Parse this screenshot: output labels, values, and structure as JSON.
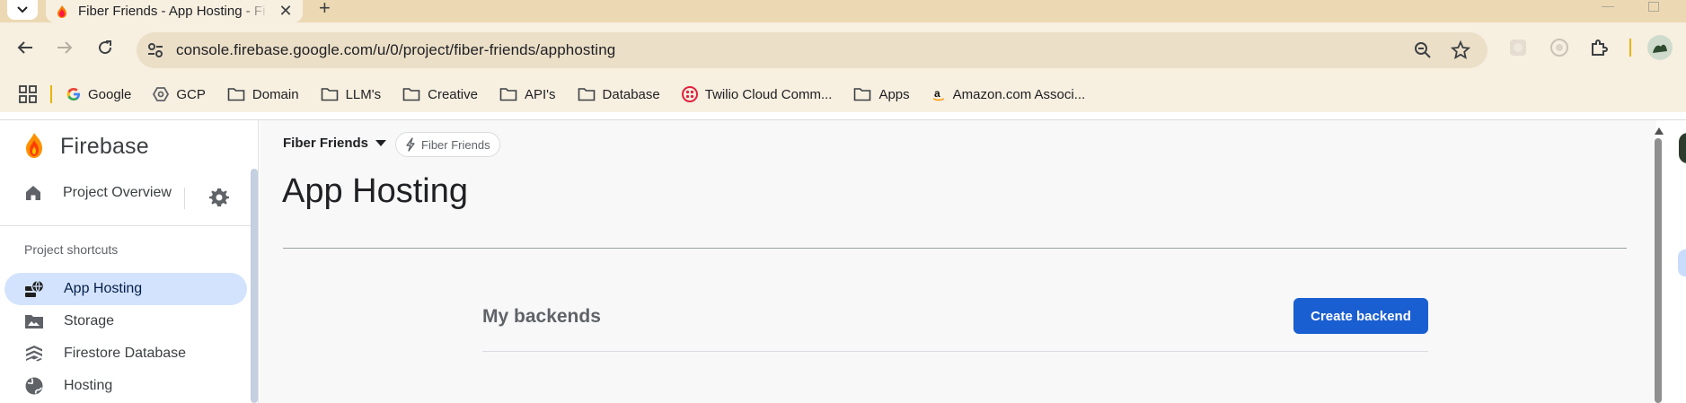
{
  "browser": {
    "tab": {
      "title": "Fiber Friends - App Hosting - Fi"
    },
    "address_bar": {
      "url": "console.firebase.google.com/u/0/project/fiber-friends/apphosting"
    },
    "bookmarks": [
      {
        "label": "Google",
        "icon": "google-icon"
      },
      {
        "label": "GCP",
        "icon": "gcp-icon"
      },
      {
        "label": "Domain",
        "icon": "folder-icon"
      },
      {
        "label": "LLM's",
        "icon": "folder-icon"
      },
      {
        "label": "Creative",
        "icon": "folder-icon"
      },
      {
        "label": "API's",
        "icon": "folder-icon"
      },
      {
        "label": "Database",
        "icon": "folder-icon"
      },
      {
        "label": "Twilio Cloud Comm...",
        "icon": "twilio-icon"
      },
      {
        "label": "Apps",
        "icon": "folder-icon"
      },
      {
        "label": "Amazon.com Associ...",
        "icon": "amazon-icon"
      }
    ]
  },
  "sidebar": {
    "brand": "Firebase",
    "project_overview": "Project Overview",
    "shortcuts_title": "Project shortcuts",
    "items": [
      {
        "label": "App Hosting",
        "icon": "app-hosting-icon",
        "active": true
      },
      {
        "label": "Storage",
        "icon": "storage-icon"
      },
      {
        "label": "Firestore Database",
        "icon": "firestore-icon"
      },
      {
        "label": "Hosting",
        "icon": "hosting-icon"
      }
    ]
  },
  "header": {
    "project_name": "Fiber Friends",
    "project_chip": "Fiber Friends",
    "page_title": "App Hosting"
  },
  "main": {
    "section_title": "My backends",
    "create_button": "Create backend"
  },
  "colors": {
    "tab_strip": "#ecd9b3",
    "toolbar": "#f7efe0",
    "primary_button": "#1a5fd1",
    "active_nav": "#d3e3fd"
  }
}
